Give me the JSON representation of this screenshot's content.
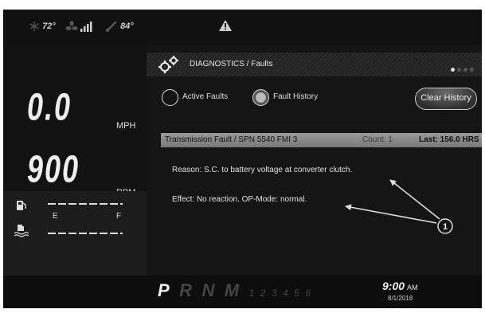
{
  "status_bar": {
    "outside_temp": "72°",
    "engine_temp": "84°"
  },
  "speed": {
    "value": "0.0",
    "unit": "MPH"
  },
  "rpm": {
    "value": "900",
    "unit": "RPM"
  },
  "fuel_gauge": {
    "empty_label": "E",
    "full_label": "F"
  },
  "panel": {
    "title": "DIAGNOSTICS / Faults",
    "page_count": 4,
    "active_page": 1,
    "radio_active_faults": "Active Faults",
    "radio_fault_history": "Fault History",
    "clear_history_button": "Clear History"
  },
  "fault": {
    "title": "Transmission Fault / SPN 5540 FMI 3",
    "count": "Count: 1",
    "last": "Last: 156.0 HRS",
    "reason": "Reason: S.C. to battery voltage at converter clutch.",
    "effect": "Effect: No reaction. OP-Mode: normal."
  },
  "callout": {
    "label": "1"
  },
  "gear_selector": {
    "gears": [
      "P",
      "R",
      "N",
      "M"
    ],
    "numbers": [
      "1",
      "2",
      "3",
      "4",
      "5",
      "6"
    ],
    "active": "P"
  },
  "clock": {
    "time": "9:00",
    "ampm": "AM",
    "date": "8/1/2018"
  },
  "colors": {
    "background": "#141414",
    "text": "#e6e6e6",
    "fault_row": "#8a8a8a"
  }
}
